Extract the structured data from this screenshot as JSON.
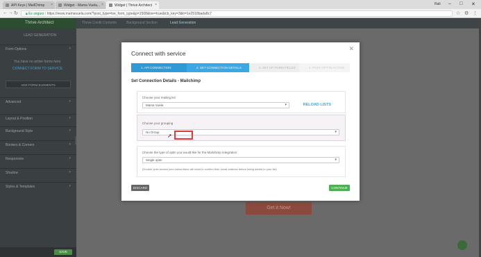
{
  "browser": {
    "tabs": [
      {
        "label": "API Keys | MailChimp"
      },
      {
        "label": "Widget - Mama Vuela..."
      },
      {
        "label": "Widget | Thrive Architect"
      }
    ],
    "user": "Rali",
    "url_secure": "Es seguro",
    "url": "https://www.mamavuela.com/?post_type=tve_form_type&p=1508&tve=true&tcb_key=3&tr=1e2518bada8c7"
  },
  "editor": {
    "sidebar": {
      "title": "Thrive Architect",
      "lead_generation": "LEAD GENERATION",
      "form_options": "Form Options",
      "no_service": "You have no active forms here",
      "connect": "CONNECT FORM TO SERVICE",
      "add_form_button": "ADD FORM ELEMENTS",
      "sections": [
        "Advanced",
        "Layout & Position",
        "Background Style",
        "Borders & Corners",
        "Responsive",
        "Shadow",
        "Styles & Templates"
      ],
      "save_label": "SAVE"
    },
    "topbar": [
      "Thrive Credit Contents",
      "Background Section",
      "Lead Generation"
    ],
    "ghost_button": "Get it Now!"
  },
  "modal": {
    "title": "Connect with service",
    "steps": [
      {
        "label": "1. API CONNECTION",
        "state": "done"
      },
      {
        "label": "2. SET CONNECTION DETAILS",
        "state": "active"
      },
      {
        "label": "3. SET UP FORM FIELDS",
        "state": "pending"
      },
      {
        "label": "4. POST OPT-IN ACTION",
        "state": "pending"
      }
    ],
    "subtitle": "Set Connection Details - Mailchimp",
    "mailing_list": {
      "label": "Choose your mailing list",
      "value": "Mama Vuela",
      "reload": "RELOAD LISTS"
    },
    "grouping": {
      "label": "Choose your grouping",
      "value": "No Group"
    },
    "optin": {
      "label": "Choose the type of optin you would like for the Mailchimp integration",
      "value": "Single optin",
      "hint": "(Double optin means your subscribers will need to confirm their email address before being added to your list)"
    },
    "discard_label": "DISCARD",
    "continue_label": "CONTINUE"
  },
  "colors": {
    "step_active": "#3aa8e3",
    "continue": "#4caf50",
    "highlight": "#e03a3a"
  }
}
